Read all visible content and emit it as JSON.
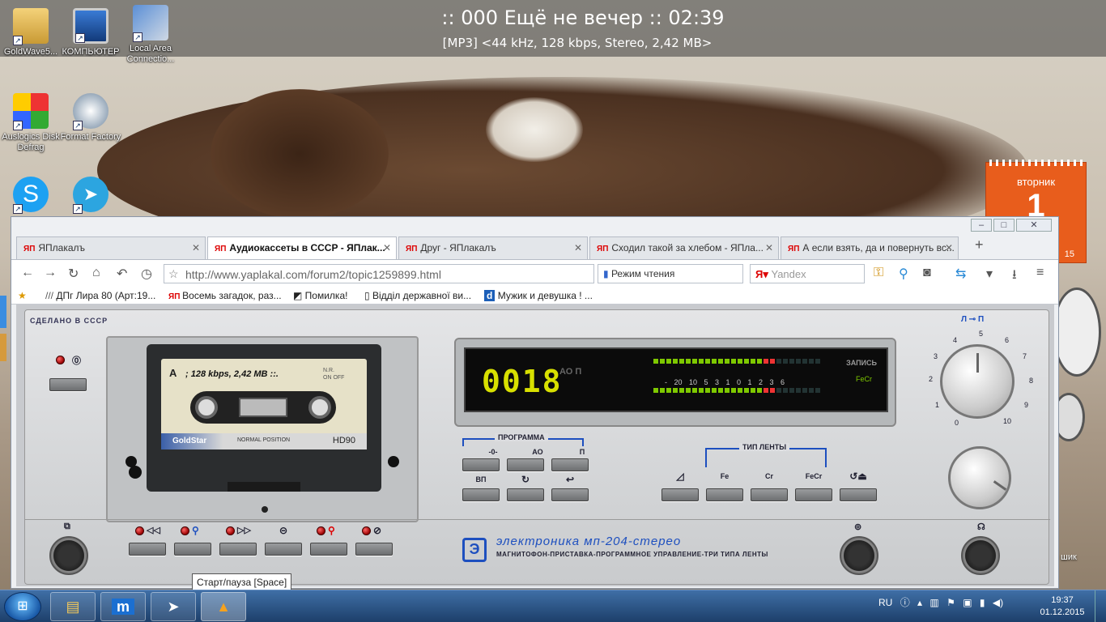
{
  "now_playing": {
    "title": ":: 000 Ещё не вечер :: 02:39",
    "info": "[MP3] <44 kHz, 128 kbps, Stereo, 2,42 MB>"
  },
  "desktop_icons": [
    {
      "label": "GoldWave5...",
      "icon": "folder-icon"
    },
    {
      "label": "КОМПЬЮТЕР",
      "icon": "computer-icon"
    },
    {
      "label": "Local Area Connectio...",
      "icon": "network-icon"
    },
    {
      "label": "Auslogics Disk Defrag",
      "icon": "defrag-icon"
    },
    {
      "label": "Format Factory",
      "icon": "format-factory-icon"
    },
    {
      "label": "",
      "icon": "skype-icon"
    },
    {
      "label": "",
      "icon": "telegram-icon"
    }
  ],
  "calendar": {
    "weekday": "вторник",
    "day": "1",
    "sub": "15"
  },
  "browser": {
    "tabs": [
      {
        "label": "ЯПлакалъ",
        "favicon": "ЯП",
        "active": false
      },
      {
        "label": "Аудиокассеты в СССР - ЯПлак...",
        "favicon": "ЯП",
        "active": true
      },
      {
        "label": "Друг - ЯПлакалъ",
        "favicon": "ЯП",
        "active": false
      },
      {
        "label": "Сходил такой за хлебом - ЯПла...",
        "favicon": "ЯП",
        "active": false
      },
      {
        "label": "А если взять, да и повернуть вс...",
        "favicon": "ЯП",
        "active": false
      }
    ],
    "new_tab_label": "+",
    "url": "http://www.yaplakal.com/forum2/topic1259899.html",
    "reader_mode_label": "Режим чтения",
    "search_placeholder": "Yandex",
    "bookmarks": [
      {
        "label": "ДПг Лира 80 (Арт:19...",
        "icon": "lyra-icon"
      },
      {
        "label": "Восемь загадок, раз...",
        "icon": "yap-icon"
      },
      {
        "label": "Помилка!",
        "icon": "error-page-icon"
      },
      {
        "label": "Відділ державної ви...",
        "icon": "page-icon"
      },
      {
        "label": "Мужик и девушка ! ...",
        "icon": "d-icon"
      }
    ]
  },
  "deck": {
    "made_in": "СДЕЛАНО В СССР",
    "cassette": {
      "side": "A",
      "label_text": "; 128 kbps, 2,42 MB ::.",
      "nr": "N.R.",
      "on_off": "ON  OFF",
      "brand": "GoldStar",
      "position": "NORMAL POSITION",
      "type": "HD90"
    },
    "counter": "0018",
    "ao_label": "АО П",
    "meter_scale": "- 20 10 5 3 1 0 1 2 3 6",
    "meter_levels": [
      0.72,
      0.72
    ],
    "record_label": "ЗАПИСЬ",
    "tape_type_indicator": "FeCr",
    "program_group_label": "ПРОГРАММА",
    "program_buttons": [
      "-0-",
      "АО",
      "П",
      "ВП",
      "↻",
      "↩"
    ],
    "tape_type_group_label": "ТИП ЛЕНТЫ",
    "tape_buttons": [
      "◿",
      "Fe",
      "Cr",
      "FeCr",
      "↺⏏"
    ],
    "transport_buttons": [
      "◁◁",
      "⚲",
      "▷▷",
      "⊝",
      "⚲",
      "⊘"
    ],
    "level_knob_ticks": [
      "0",
      "1",
      "2",
      "3",
      "4",
      "5",
      "6",
      "7",
      "8",
      "9",
      "10"
    ],
    "logo_title": "электроника мп-204-стерео",
    "logo_subtitle": "МАГНИТОФОН-ПРИСТАВКА-ПРОГРАММНОЕ УПРАВЛЕНИЕ-ТРИ ТИПА ЛЕНТЫ",
    "logo_mark": "Э"
  },
  "tooltip": "Старт/пауза [Space]",
  "taskbar": {
    "apps": [
      {
        "icon": "explorer-icon",
        "glyph": "▤"
      },
      {
        "icon": "maxthon-icon",
        "glyph": "m"
      },
      {
        "icon": "telegram-icon",
        "glyph": "➤"
      },
      {
        "icon": "aimp-icon",
        "glyph": "▲"
      }
    ],
    "language": "RU",
    "time": "19:37",
    "date": "01.12.2015"
  },
  "right_gadget_text": "шик"
}
